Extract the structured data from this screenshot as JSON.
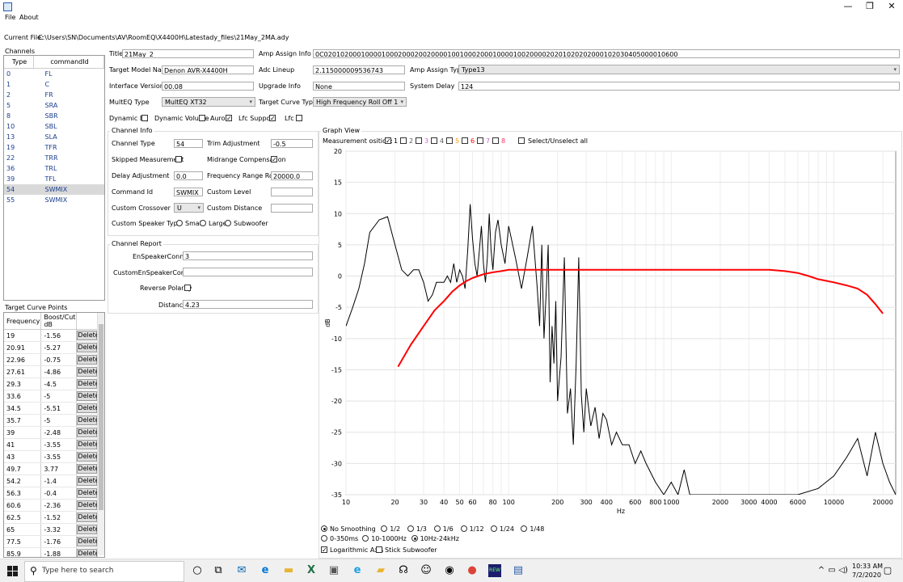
{
  "window": {
    "icon": "app-icon",
    "minimize": "—",
    "maximize": "❐",
    "close": "✕"
  },
  "menu": {
    "file": "File",
    "about": "About"
  },
  "current_file": {
    "label": "Current File:",
    "path": "C:\\Users\\SN\\Documents\\AV\\RoomEQ\\X4400H\\Latestady_files\\21May_2MA.ady"
  },
  "channels": {
    "title": "Channels",
    "headers": [
      "Type",
      "commandId"
    ],
    "rows": [
      [
        "0",
        "FL"
      ],
      [
        "1",
        "C"
      ],
      [
        "2",
        "FR"
      ],
      [
        "5",
        "SRA"
      ],
      [
        "8",
        "SBR"
      ],
      [
        "10",
        "SBL"
      ],
      [
        "13",
        "SLA"
      ],
      [
        "19",
        "TFR"
      ],
      [
        "22",
        "TRR"
      ],
      [
        "36",
        "TRL"
      ],
      [
        "39",
        "TFL"
      ],
      [
        "54",
        "SWMIX"
      ],
      [
        "55",
        "SWMIX"
      ]
    ],
    "selected_index": 11
  },
  "target_curve": {
    "title": "Target Curve Points",
    "headers": [
      "Frequency",
      "Boost/Cut dB"
    ],
    "delete_label": "Delete",
    "rows": [
      [
        "19",
        "-1.56"
      ],
      [
        "20.91",
        "-5.27"
      ],
      [
        "22.96",
        "-0.75"
      ],
      [
        "27.61",
        "-4.86"
      ],
      [
        "29.3",
        "-4.5"
      ],
      [
        "33.6",
        "-5"
      ],
      [
        "34.5",
        "-5.51"
      ],
      [
        "35.7",
        "-5"
      ],
      [
        "39",
        "-2.48"
      ],
      [
        "41",
        "-3.55"
      ],
      [
        "43",
        "-3.55"
      ],
      [
        "49.7",
        "3.77"
      ],
      [
        "54.2",
        "-1.4"
      ],
      [
        "56.3",
        "-0.4"
      ],
      [
        "60.6",
        "-2.36"
      ],
      [
        "62.5",
        "-1.52"
      ],
      [
        "65",
        "-3.32"
      ],
      [
        "77.5",
        "-1.76"
      ],
      [
        "85.9",
        "-1.88"
      ]
    ]
  },
  "fields": {
    "title_label": "Title",
    "title_value": "21May_2",
    "amp_assign_info_label": "Amp Assign Info",
    "amp_assign_info_value": "0C02010200010000100020002002000010010002000100001002000020201020202000102030405000010600",
    "target_model_label": "Target Model Name",
    "target_model_value": "Denon AVR-X4400H",
    "adc_lineup_label": "Adc Lineup",
    "adc_lineup_value": "2.115000009536743",
    "amp_assign_type_label": "Amp Assign Type",
    "amp_assign_type_value": "Type13",
    "interface_version_label": "Interface Version",
    "interface_version_value": "00.08",
    "upgrade_info_label": "Upgrade Info",
    "upgrade_info_value": "None",
    "system_delay_label": "System Delay",
    "system_delay_value": "124",
    "multeq_type_label": "MultEQ Type",
    "multeq_type_value": "MultEQ XT32",
    "target_curve_type_label": "Target Curve Type",
    "target_curve_type_value": "High Frequency Roll Off 1",
    "dynamic_eq_label": "Dynamic Eq",
    "dynamic_volume_label": "Dynamic Volume",
    "auro_label": "Auro",
    "lfc_support_label": "Lfc Support",
    "lfc_label": "Lfc"
  },
  "channel_info": {
    "title": "Channel Info",
    "channel_type_label": "Channel Type",
    "channel_type_value": "54",
    "trim_label": "Trim Adjustment",
    "trim_value": "-0.5",
    "skipped_label": "Skipped Measurement",
    "midrange_label": "Midrange Compensation",
    "delay_label": "Delay Adjustment",
    "delay_value": "0.0",
    "rolloff_label": "Frequency Range Rolloff",
    "rolloff_value": "20000.0",
    "command_id_label": "Command Id",
    "command_id_value": "SWMIX",
    "custom_level_label": "Custom Level",
    "custom_crossover_label": "Custom Crossover",
    "custom_crossover_value": "U",
    "custom_distance_label": "Custom Distance",
    "speaker_type_label": "Custom Speaker Type",
    "small_label": "Small",
    "large_label": "Large",
    "subwoofer_label": "Subwoofer"
  },
  "channel_report": {
    "title": "Channel Report",
    "en_speaker_label": "EnSpeakerConnect",
    "en_speaker_value": "3",
    "custom_en_speaker_label": "CustomEnSpeakerConnect",
    "reverse_polarity_label": "Reverse Polarity",
    "distance_label": "Distance",
    "distance_value": "4.23"
  },
  "graph": {
    "title": "Graph View",
    "measurement_label": "Measurement osition:",
    "positions": [
      "1",
      "2",
      "3",
      "4",
      "5",
      "6",
      "7",
      "8"
    ],
    "position_colors": [
      "#000000",
      "#555555",
      "#cc66cc",
      "#555555",
      "#ff9900",
      "#ff0000",
      "#cc66cc",
      "#ff3366"
    ],
    "select_all_label": "Select/Unselect all",
    "smoothing": [
      "No Smoothing",
      "1/2",
      "1/3",
      "1/6",
      "1/12",
      "1/24",
      "1/48"
    ],
    "range": [
      "0-350ms",
      "10-1000Hz",
      "10Hz-24kHz"
    ],
    "log_axis_label": "Logarithmic Axis",
    "stick_sub_label": "Stick Subwoofer"
  },
  "chart_data": {
    "type": "line",
    "xlabel": "Hz",
    "ylabel": "dB",
    "xscale": "log",
    "xlim": [
      10,
      24000
    ],
    "ylim": [
      -35,
      20
    ],
    "yticks": [
      20,
      15,
      10,
      5,
      0,
      -5,
      -10,
      -15,
      -20,
      -25,
      -30,
      -35
    ],
    "xticks": [
      10,
      20,
      30,
      40,
      50,
      60,
      80,
      100,
      200,
      300,
      400,
      600,
      800,
      1000,
      2000,
      3000,
      4000,
      6000,
      10000,
      20000
    ],
    "xtick_labels": [
      "10",
      "20",
      "30",
      "40",
      "50",
      "60",
      "80",
      "100",
      "200",
      "300",
      "400",
      "600",
      "800",
      "1000",
      "2000",
      "3000",
      "4000",
      "6000",
      "10000",
      "20000"
    ],
    "grid": true,
    "series": [
      {
        "color": "#000000",
        "x": [
          10,
          11,
          12,
          13,
          14,
          16,
          18,
          20,
          21,
          22,
          24,
          26,
          28,
          30,
          32,
          34,
          36,
          38,
          40,
          42,
          44,
          46,
          48,
          50,
          52,
          54,
          56,
          58,
          60,
          62,
          64,
          66,
          68,
          70,
          72,
          74,
          76,
          78,
          80,
          83,
          86,
          90,
          95,
          100,
          110,
          120,
          130,
          140,
          150,
          155,
          160,
          165,
          170,
          175,
          180,
          185,
          190,
          195,
          200,
          210,
          220,
          230,
          240,
          250,
          260,
          270,
          280,
          290,
          300,
          320,
          340,
          360,
          380,
          400,
          430,
          460,
          500,
          550,
          600,
          650,
          700,
          800,
          900,
          1000,
          1100,
          1200,
          1300,
          1500,
          1700,
          2000,
          2500,
          3000,
          3500,
          4000,
          5000,
          6000,
          8000,
          10000,
          12000,
          14000,
          16000,
          18000,
          20000,
          22000,
          24000
        ],
        "y": [
          -8,
          -5,
          -2,
          2,
          7,
          9,
          9.5,
          5,
          3,
          1,
          0,
          1,
          1,
          -1,
          -4,
          -3,
          -1,
          -1,
          -1,
          0,
          -1,
          2,
          -1,
          1,
          0,
          -2,
          4,
          11.5,
          6,
          2,
          0,
          4,
          8,
          2,
          -1,
          3,
          10,
          4,
          1,
          7,
          9,
          5,
          2,
          8,
          3,
          -2,
          3,
          8,
          -2,
          -8,
          5,
          -10,
          -3,
          5,
          -17,
          -8,
          -14,
          -4,
          -20,
          -13,
          3,
          -22,
          -18,
          -27,
          -14,
          3,
          -19,
          -25,
          -18,
          -24,
          -21,
          -26,
          -22,
          -23,
          -27,
          -25,
          -27,
          -27,
          -30,
          -28,
          -30,
          -33,
          -35,
          -33,
          -35,
          -31,
          -35,
          -35,
          -35,
          -35,
          -35,
          -35,
          -35,
          -35,
          -35,
          -35,
          -34,
          -32,
          -29,
          -26,
          -32,
          -25,
          -30,
          -33,
          -35
        ]
      },
      {
        "color": "#ff0000",
        "x": [
          20.91,
          25,
          30,
          35,
          40,
          45,
          50,
          55,
          60,
          65,
          70,
          80,
          90,
          100,
          150,
          200,
          500,
          1000,
          2000,
          3000,
          4000,
          5000,
          6000,
          7000,
          8000,
          10000,
          12000,
          14000,
          16000,
          18000,
          20000
        ],
        "y": [
          -14.5,
          -11,
          -8,
          -5.5,
          -4,
          -2.5,
          -1.5,
          -0.8,
          -0.3,
          0,
          0.3,
          0.6,
          0.8,
          1,
          1,
          1,
          1,
          1,
          1,
          1,
          1,
          0.8,
          0.5,
          0,
          -0.5,
          -1,
          -1.5,
          -2,
          -3,
          -4.5,
          -6
        ]
      }
    ]
  },
  "taskbar": {
    "search_placeholder": "Type here to search",
    "time": "10:33 AM",
    "date": "7/2/2020"
  }
}
